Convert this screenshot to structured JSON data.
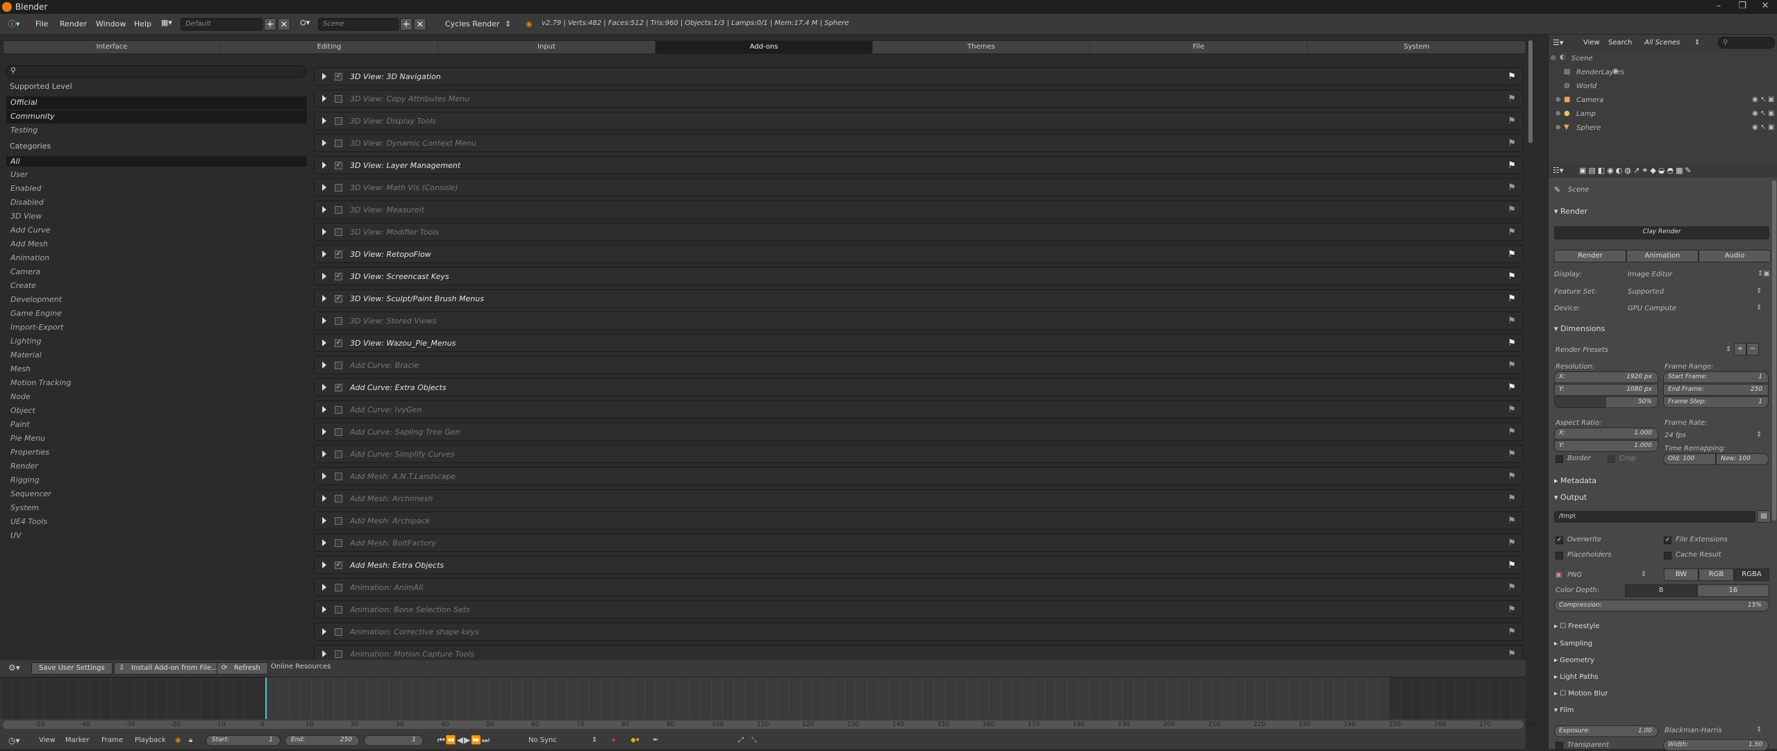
{
  "window": {
    "title": "Blender"
  },
  "menu": {
    "file": "File",
    "render": "Render",
    "window": "Window",
    "help": "Help"
  },
  "layout": {
    "value": "Default"
  },
  "scene": {
    "value": "Scene"
  },
  "engine": {
    "value": "Cycles Render"
  },
  "stats": "v2.79 | Verts:482 | Faces:512 | Tris:960 | Objects:1/3 | Lamps:0/1 | Mem:17.4 M | Sphere",
  "tabs": [
    "Interface",
    "Editing",
    "Input",
    "Add-ons",
    "Themes",
    "File",
    "System"
  ],
  "active_tab": "Add-ons",
  "sidebar": {
    "supported_label": "Supported Level",
    "levels": [
      "Official",
      "Community",
      "Testing"
    ],
    "categories_label": "Categories",
    "categories": [
      "All",
      "User",
      "Enabled",
      "Disabled",
      "3D View",
      "Add Curve",
      "Add Mesh",
      "Animation",
      "Camera",
      "Create",
      "Development",
      "Game Engine",
      "Import-Export",
      "Lighting",
      "Material",
      "Mesh",
      "Motion Tracking",
      "Node",
      "Object",
      "Paint",
      "Pie Menu",
      "Properties",
      "Render",
      "Rigging",
      "Sequencer",
      "System",
      "UE4 Tools",
      "UV"
    ]
  },
  "addons": [
    {
      "name": "3D View: 3D Navigation",
      "enabled": true
    },
    {
      "name": "3D View: Copy Attributes Menu",
      "enabled": false
    },
    {
      "name": "3D View: Display Tools",
      "enabled": false
    },
    {
      "name": "3D View: Dynamic Context Menu",
      "enabled": false
    },
    {
      "name": "3D View: Layer Management",
      "enabled": true
    },
    {
      "name": "3D View: Math Vis (Console)",
      "enabled": false
    },
    {
      "name": "3D View: MeasureIt",
      "enabled": false
    },
    {
      "name": "3D View: Modifier Tools",
      "enabled": false
    },
    {
      "name": "3D View: RetopoFlow",
      "enabled": true
    },
    {
      "name": "3D View: Screencast Keys",
      "enabled": true
    },
    {
      "name": "3D View: Sculpt/Paint Brush Menus",
      "enabled": true
    },
    {
      "name": "3D View: Stored Views",
      "enabled": false
    },
    {
      "name": "3D View: Wazou_Pie_Menus",
      "enabled": true
    },
    {
      "name": "Add Curve: Bracie",
      "enabled": false
    },
    {
      "name": "Add Curve: Extra Objects",
      "enabled": true
    },
    {
      "name": "Add Curve: IvyGen",
      "enabled": false
    },
    {
      "name": "Add Curve: Sapling Tree Gen",
      "enabled": false
    },
    {
      "name": "Add Curve: Simplify Curves",
      "enabled": false
    },
    {
      "name": "Add Mesh: A.N.T.Landscape",
      "enabled": false
    },
    {
      "name": "Add Mesh: Archimesh",
      "enabled": false
    },
    {
      "name": "Add Mesh: Archipack",
      "enabled": false
    },
    {
      "name": "Add Mesh: BoltFactory",
      "enabled": false
    },
    {
      "name": "Add Mesh: Extra Objects",
      "enabled": true
    },
    {
      "name": "Animation: AnimAll",
      "enabled": false
    },
    {
      "name": "Animation: Bone Selection Sets",
      "enabled": false
    },
    {
      "name": "Animation: Corrective shape keys",
      "enabled": false
    },
    {
      "name": "Animation: Motion Capture Tools",
      "enabled": false
    }
  ],
  "footer": {
    "save": "Save User Settings",
    "install": "Install Add-on from File...",
    "refresh": "Refresh",
    "online": "Online Resources"
  },
  "timeline": {
    "menu": [
      "View",
      "Marker",
      "Frame",
      "Playback"
    ],
    "start": "Start:",
    "start_val": "1",
    "end": "End:",
    "end_val": "250",
    "current": "1",
    "sync": "No Sync",
    "ticks": [
      "-50",
      "-40",
      "-30",
      "-20",
      "-10",
      "0",
      "10",
      "20",
      "30",
      "40",
      "50",
      "60",
      "70",
      "80",
      "90",
      "100",
      "110",
      "120",
      "130",
      "140",
      "150",
      "160",
      "170",
      "180",
      "190",
      "200",
      "210",
      "220",
      "230",
      "240",
      "250",
      "260",
      "270",
      "280"
    ]
  },
  "outliner": {
    "view": "View",
    "search": "Search",
    "all_scenes": "All Scenes",
    "items": [
      "Scene",
      "RenderLayers",
      "World",
      "Camera",
      "Lamp",
      "Sphere"
    ]
  },
  "properties": {
    "scene": "Scene",
    "render_panel": "Render",
    "clay": "Clay Render",
    "render_btn": "Render",
    "animation_btn": "Animation",
    "audio_btn": "Audio",
    "display_label": "Display:",
    "display_val": "Image Editor",
    "feature_label": "Feature Set:",
    "feature_val": "Supported",
    "device_label": "Device:",
    "device_val": "GPU Compute",
    "dimensions": "Dimensions",
    "presets": "Render Presets",
    "resolution": "Resolution:",
    "res_x": "X:",
    "res_x_val": "1920 px",
    "res_y": "Y:",
    "res_y_val": "1080 px",
    "res_pct": "50%",
    "frame_range": "Frame Range:",
    "start_frame": "Start Frame:",
    "start_frame_val": "1",
    "end_frame": "End Frame:",
    "end_frame_val": "250",
    "frame_step": "Frame Step:",
    "frame_step_val": "1",
    "aspect": "Aspect Ratio:",
    "asp_x": "X:",
    "asp_x_val": "1.000",
    "asp_y": "Y:",
    "asp_y_val": "1.000",
    "frame_rate": "Frame Rate:",
    "fps": "24 fps",
    "time_remap": "Time Remapping:",
    "old": "Old: 100",
    "new": "New: 100",
    "border": "Border",
    "crop": "Crop",
    "metadata": "Metadata",
    "output": "Output",
    "path": "/tmp\\",
    "overwrite": "Overwrite",
    "file_ext": "File Extensions",
    "placeholders": "Placeholders",
    "cache": "Cache Result",
    "format": "PNG",
    "bw": "BW",
    "rgb": "RGB",
    "rgba": "RGBA",
    "color_depth": "Color Depth:",
    "depth8": "8",
    "depth16": "16",
    "compression": "Compression:",
    "compression_val": "15%",
    "freestyle": "Freestyle",
    "sampling": "Sampling",
    "geometry": "Geometry",
    "light_paths": "Light Paths",
    "motion_blur": "Motion Blur",
    "film": "Film",
    "exposure": "Exposure:",
    "exposure_val": "1.00",
    "filter": "Blackman-Harris",
    "transparent": "Transparent",
    "width": "Width:",
    "width_val": "1.50"
  },
  "colors": {
    "accent": "#e87d0d",
    "cursor": "#4bc0c8"
  }
}
